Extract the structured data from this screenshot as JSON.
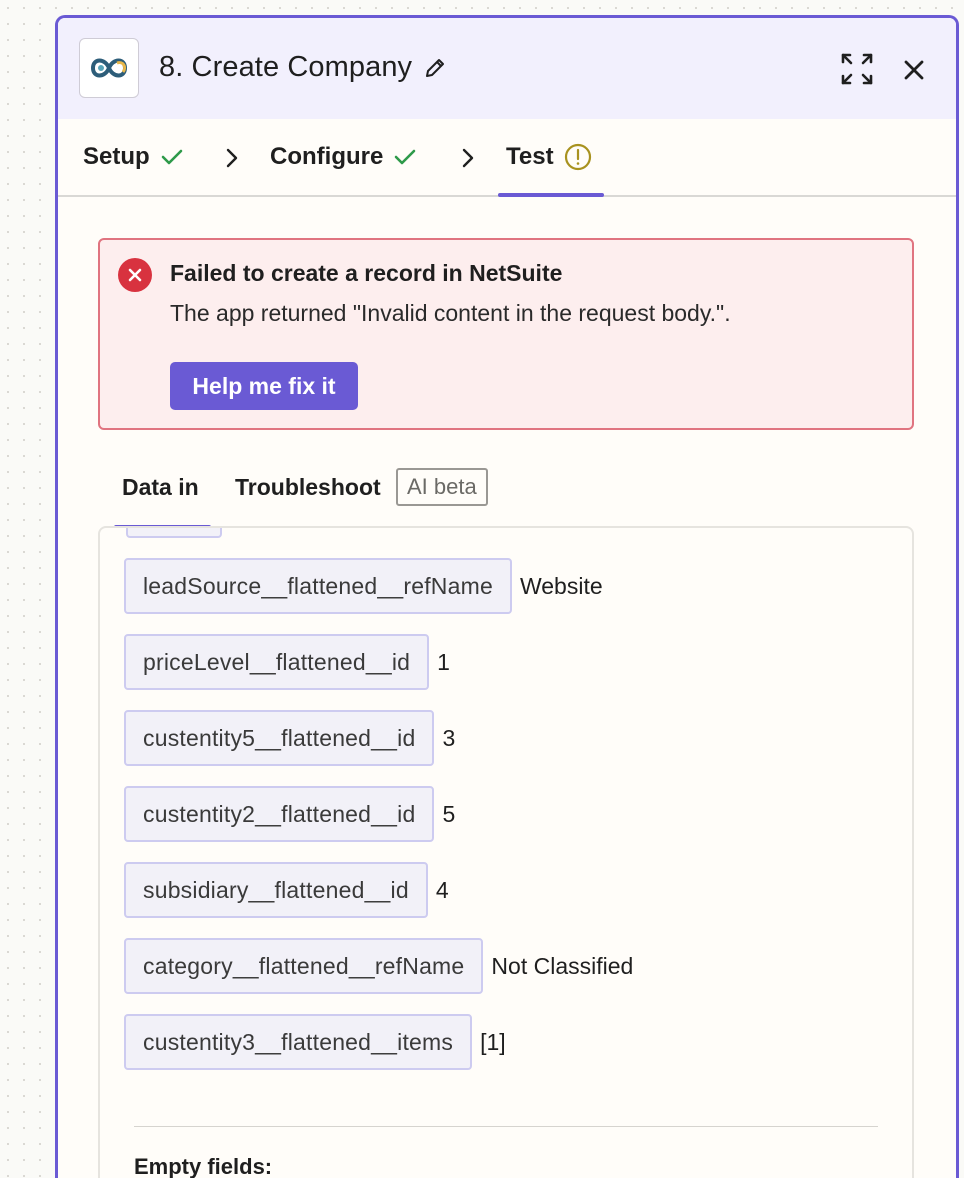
{
  "header": {
    "app_icon": "netsuite-logo",
    "title": "8. Create Company",
    "edit_icon": "pencil-icon",
    "expand_icon": "expand-arrows-icon",
    "close_icon": "close-icon"
  },
  "steps": [
    {
      "label": "Setup",
      "status": "complete"
    },
    {
      "label": "Configure",
      "status": "complete"
    },
    {
      "label": "Test",
      "status": "warning"
    }
  ],
  "error": {
    "title": "Failed to create a record in NetSuite",
    "message": "The app returned \"Invalid content in the request body.\".",
    "button_label": "Help me fix it"
  },
  "tabs": {
    "data_in": "Data in",
    "troubleshoot": "Troubleshoot",
    "badge": "AI beta"
  },
  "fields": [
    {
      "key": "leadSource__flattened__refName",
      "value": "Website"
    },
    {
      "key": "priceLevel__flattened__id",
      "value": "1"
    },
    {
      "key": "custentity5__flattened__id",
      "value": "3"
    },
    {
      "key": "custentity2__flattened__id",
      "value": "5"
    },
    {
      "key": "subsidiary__flattened__id",
      "value": "4"
    },
    {
      "key": "category__flattened__refName",
      "value": "Not Classified"
    },
    {
      "key": "custentity3__flattened__items",
      "value": "[1]"
    }
  ],
  "empty_fields_label": "Empty fields:",
  "colors": {
    "accent": "#6a5ad4",
    "error_red": "#d8323f",
    "success_green": "#2e9a4a",
    "warning_olive": "#a8921f"
  }
}
